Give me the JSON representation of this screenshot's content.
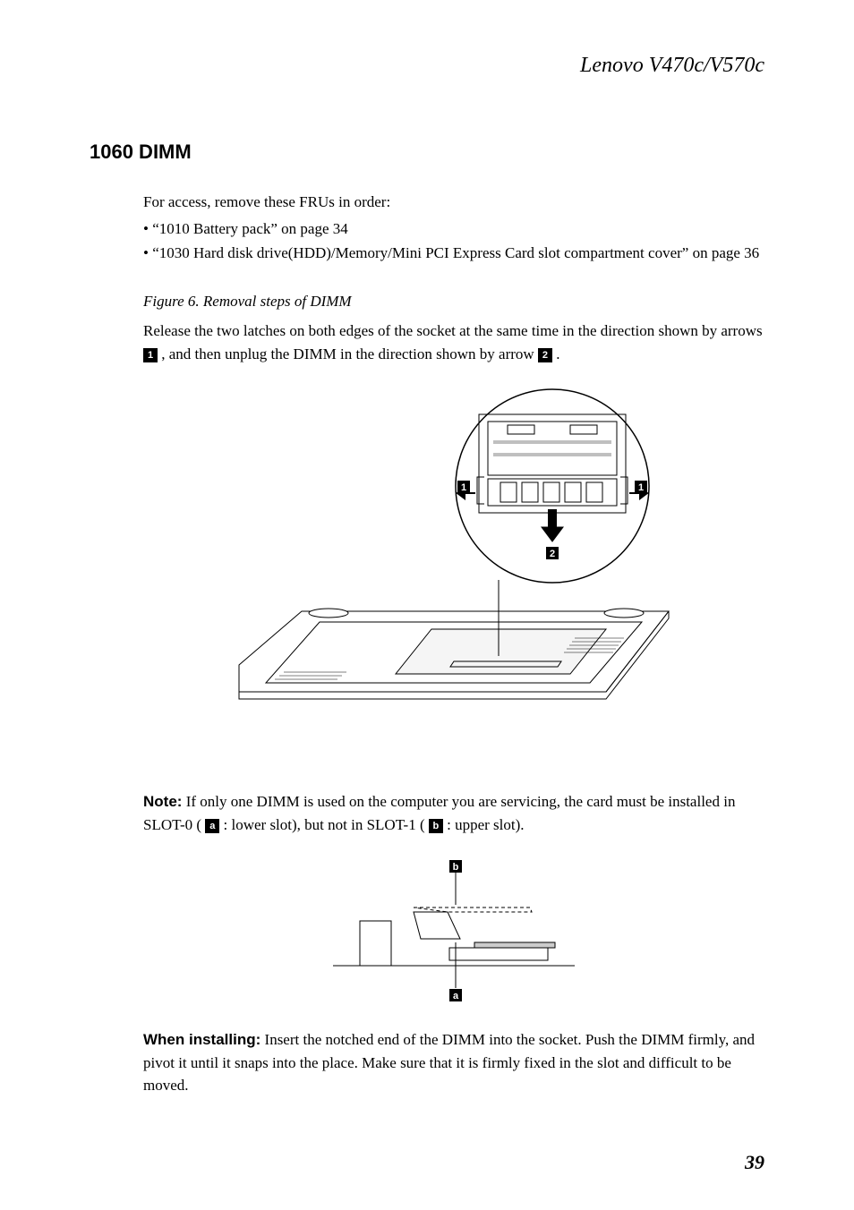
{
  "header": {
    "title": "Lenovo V470c/V570c"
  },
  "section": {
    "title": "1060 DIMM"
  },
  "intro": "For access, remove these FRUs in order:",
  "bullets": [
    "“1010 Battery pack” on page 34",
    "“1030 Hard disk drive(HDD)/Memory/Mini PCI Express Card slot compartment cover” on page 36"
  ],
  "figure_caption": "Figure 6. Removal steps of DIMM",
  "release_text": {
    "part1": "Release the two latches on both edges of the socket at the same time in the direction shown by arrows ",
    "label1": "1",
    "part2": " , and then unplug the DIMM in the direction shown by arrow ",
    "label2": "2",
    "part3": " ."
  },
  "diagram_labels": {
    "one": "1",
    "two": "2",
    "a": "a",
    "b": "b"
  },
  "note": {
    "label": "Note:",
    "part1": " If only one DIMM is used on the computer you are servicing, the card must be installed in SLOT-0 ( ",
    "label_a": "a",
    "part2": "  : lower slot), but not in SLOT-1 ( ",
    "label_b": "b",
    "part3": "  : upper slot)."
  },
  "installing": {
    "label": "When installing:",
    "text": " Insert the notched end of the DIMM into the socket. Push the DIMM firmly, and pivot it until it snaps into the place. Make sure that it is firmly fixed in the slot and difficult to be moved."
  },
  "page_number": "39"
}
